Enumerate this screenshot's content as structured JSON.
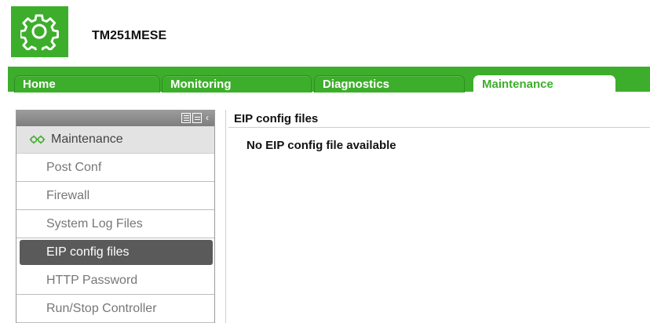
{
  "header": {
    "device_name": "TM251MESE",
    "logo_icon": "gear-icon"
  },
  "colors": {
    "brand": "#3dae2b",
    "active_item": "#5a5a5a"
  },
  "tabs": [
    {
      "label": "Home",
      "active": false
    },
    {
      "label": "Monitoring",
      "active": false
    },
    {
      "label": "Diagnostics",
      "active": false
    },
    {
      "label": "Maintenance",
      "active": true
    }
  ],
  "sidebar": {
    "title": "Maintenance",
    "title_icon": "gear-icon",
    "tools": [
      "list-view-icon",
      "compact-view-icon",
      "collapse-icon"
    ],
    "items": [
      {
        "label": "Post Conf",
        "active": false
      },
      {
        "label": "Firewall",
        "active": false
      },
      {
        "label": "System Log Files",
        "active": false
      },
      {
        "label": "EIP config files",
        "active": true
      },
      {
        "label": "HTTP Password",
        "active": false
      },
      {
        "label": "Run/Stop Controller",
        "active": false
      }
    ]
  },
  "content": {
    "title": "EIP config files",
    "message": "No EIP config file available"
  }
}
